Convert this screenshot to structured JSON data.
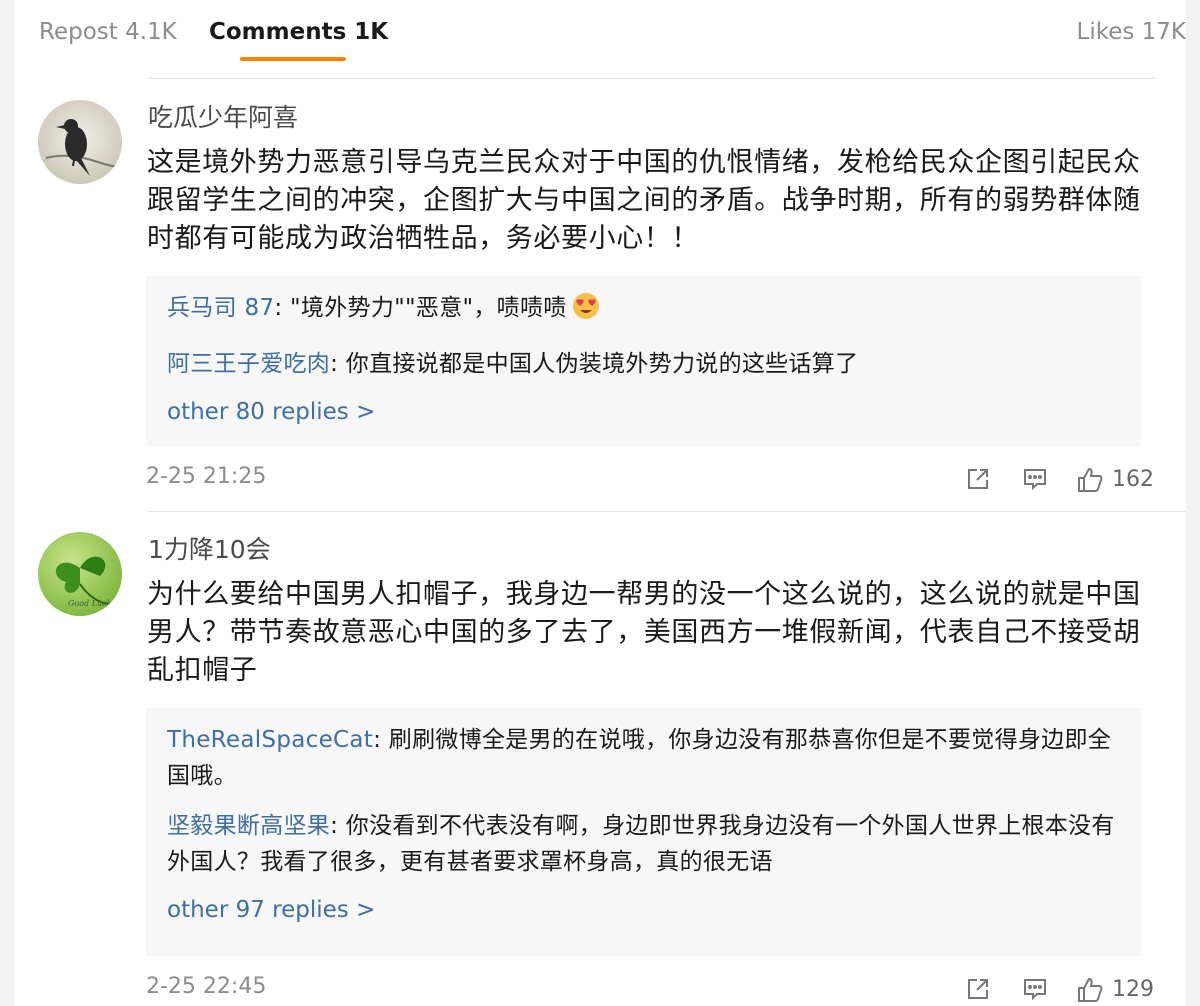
{
  "tabs": {
    "repost": "Repost 4.1K",
    "comments": "Comments 1K",
    "likes": "Likes 17K",
    "active_color": "#ff8200"
  },
  "link_color": "#3d6ea5",
  "comments": [
    {
      "user": "吃瓜少年阿喜",
      "text": "这是境外势力恶意引导乌克兰民众对于中国的仇恨情绪，发枪给民众企图引起民众跟留学生之间的冲突，企图扩大与中国之间的矛盾。战争时期，所有的弱势群体随时都有可能成为政治牺牲品，务必要小心！！",
      "replies": [
        {
          "name": "兵马司 87",
          "text": ": \"境外势力\"\"恶意\"，啧啧啧"
        },
        {
          "name": "阿三王子爱吃肉",
          "text": ": 你直接说都是中国人伪装境外势力说的这些话算了"
        }
      ],
      "more": "other 80 replies >",
      "time": "2-25 21:25",
      "likes": "162"
    },
    {
      "user": "1力降10会",
      "text": "为什么要给中国男人扣帽子，我身边一帮男的没一个这么说的，这么说的就是中国男人？带节奏故意恶心中国的多了去了，美国西方一堆假新闻，代表自己不接受胡乱扣帽子",
      "avatar_text": "Good Luck",
      "replies": [
        {
          "name": "TheRealSpaceCat",
          "text": ": 刷刷微博全是男的在说哦，你身边没有那恭喜你但是不要觉得身边即全国哦。"
        },
        {
          "name": "坚毅果断高坚果",
          "text": ": 你没看到不代表没有啊，身边即世界我身边没有一个外国人世界上根本没有外国人？我看了很多，更有甚者要求罩杯身高，真的很无语"
        }
      ],
      "more": "other 97 replies >",
      "time": "2-25 22:45",
      "likes": "129"
    }
  ]
}
